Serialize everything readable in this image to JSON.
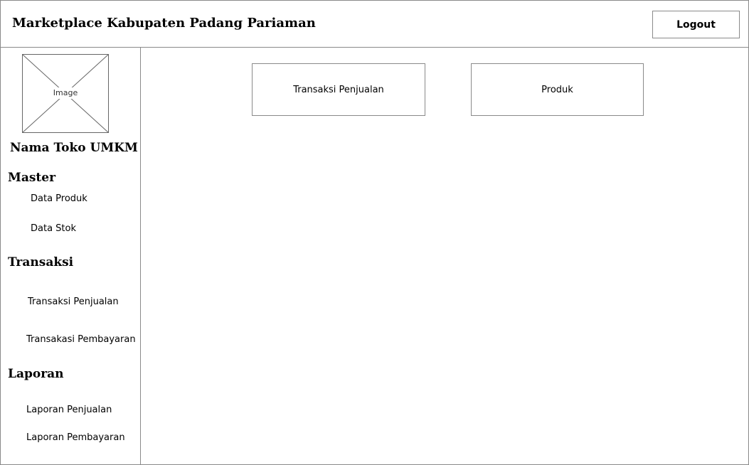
{
  "header": {
    "title": "Marketplace Kabupaten Padang Pariaman",
    "logout_label": "Logout"
  },
  "sidebar": {
    "image_placeholder_label": "Image",
    "store_name": "Nama Toko UMKM",
    "sections": [
      {
        "title": "Master",
        "items": [
          "Data Produk",
          "Data Stok"
        ]
      },
      {
        "title": "Transaksi",
        "items": [
          "Transaksi Penjualan",
          "Transakasi Pembayaran"
        ]
      },
      {
        "title": "Laporan",
        "items": [
          "Laporan Penjualan",
          "Laporan Pembayaran"
        ]
      }
    ]
  },
  "main": {
    "cards": [
      "Transaksi Penjualan",
      "Produk"
    ]
  }
}
